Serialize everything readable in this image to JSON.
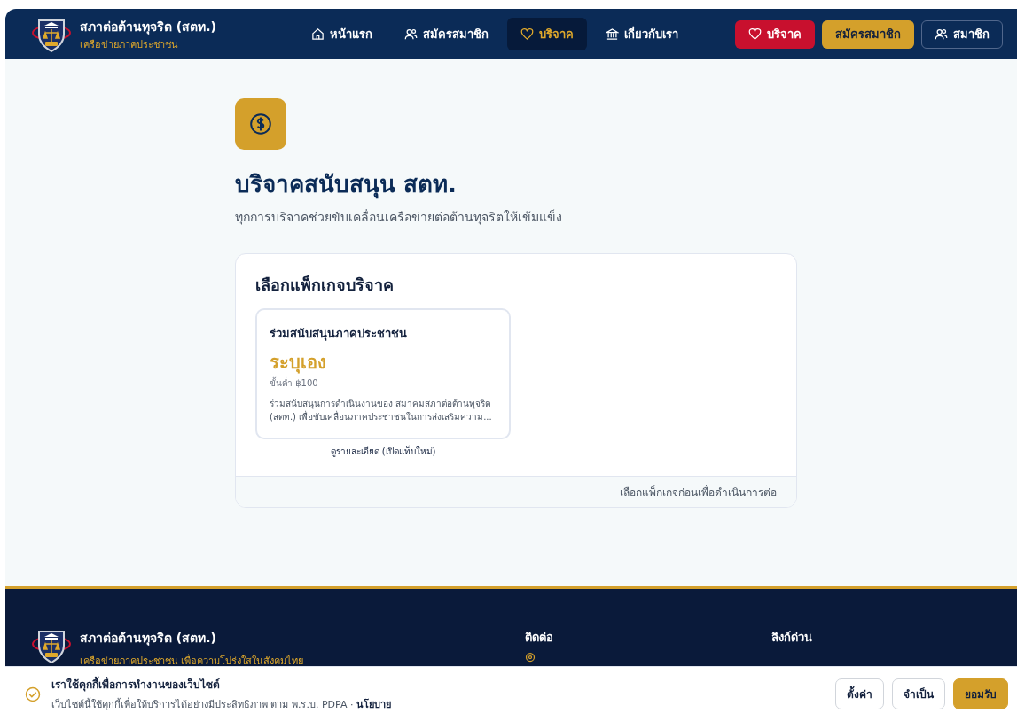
{
  "header": {
    "brand_title": "สภาต่อต้านทุจริต (สตท.)",
    "brand_subtitle": "เครือข่ายภาคประชาชน",
    "nav": [
      {
        "label": "หน้าแรก",
        "selected": false
      },
      {
        "label": "สมัครสมาชิก",
        "selected": false
      },
      {
        "label": "บริจาค",
        "selected": true
      },
      {
        "label": "เกี่ยวกับเรา",
        "selected": false
      }
    ],
    "actions": [
      {
        "kind": "donate",
        "label": "บริจาค"
      },
      {
        "kind": "join",
        "label": "สมัครสมาชิก"
      },
      {
        "kind": "member",
        "label": "สมาชิก"
      }
    ]
  },
  "page": {
    "title": "บริจาคสนับสนุน สตท.",
    "subtitle": "ทุกการบริจาคช่วยขับเคลื่อนเครือข่ายต่อต้านทุจริตให้เข้มแข็ง",
    "panel_title": "เลือกแพ็กเกจบริจาค",
    "packages": [
      {
        "name": "ร่วมสนับสนุนภาคประชาชน",
        "amount": "ระบุเอง",
        "minimum": "ขั้นต่ำ ฿100",
        "description": "ร่วมสนับสนุนการดำเนินงานของ สมาคมสภาต่อต้านทุจริต (สตท.) เพื่อขับเคลื่อนภาคประชาชนในการส่งเสริมความ...",
        "details_link": "ดูรายละเอียด (เปิดแท็บใหม่)"
      }
    ],
    "panel_hint": "เลือกแพ็กเกจก่อนเพื่อดำเนินการต่อ"
  },
  "footer": {
    "brand_title": "สภาต่อต้านทุจริต (สตท.)",
    "brand_subtitle": "เครือข่ายภาคประชาชน เพื่อความโปร่งใสในสังคมไทย",
    "contact_heading": "ติดต่อ",
    "links_heading": "ลิงก์ด่วน"
  },
  "cookie_banner": {
    "title": "เราใช้คุกกี้เพื่อการทำงานของเว็บไซต์",
    "text": "เว็บไซต์นี้ใช้คุกกี้เพื่อให้บริการได้อย่างมีประสิทธิภาพ ตาม พ.ร.บ. PDPA · ",
    "policy_link": "นโยบาย",
    "buttons": [
      {
        "kind": "outline",
        "label": "ตั้งค่า"
      },
      {
        "kind": "outline",
        "label": "จำเป็น"
      },
      {
        "kind": "primary",
        "label": "ยอมรับ"
      }
    ]
  }
}
